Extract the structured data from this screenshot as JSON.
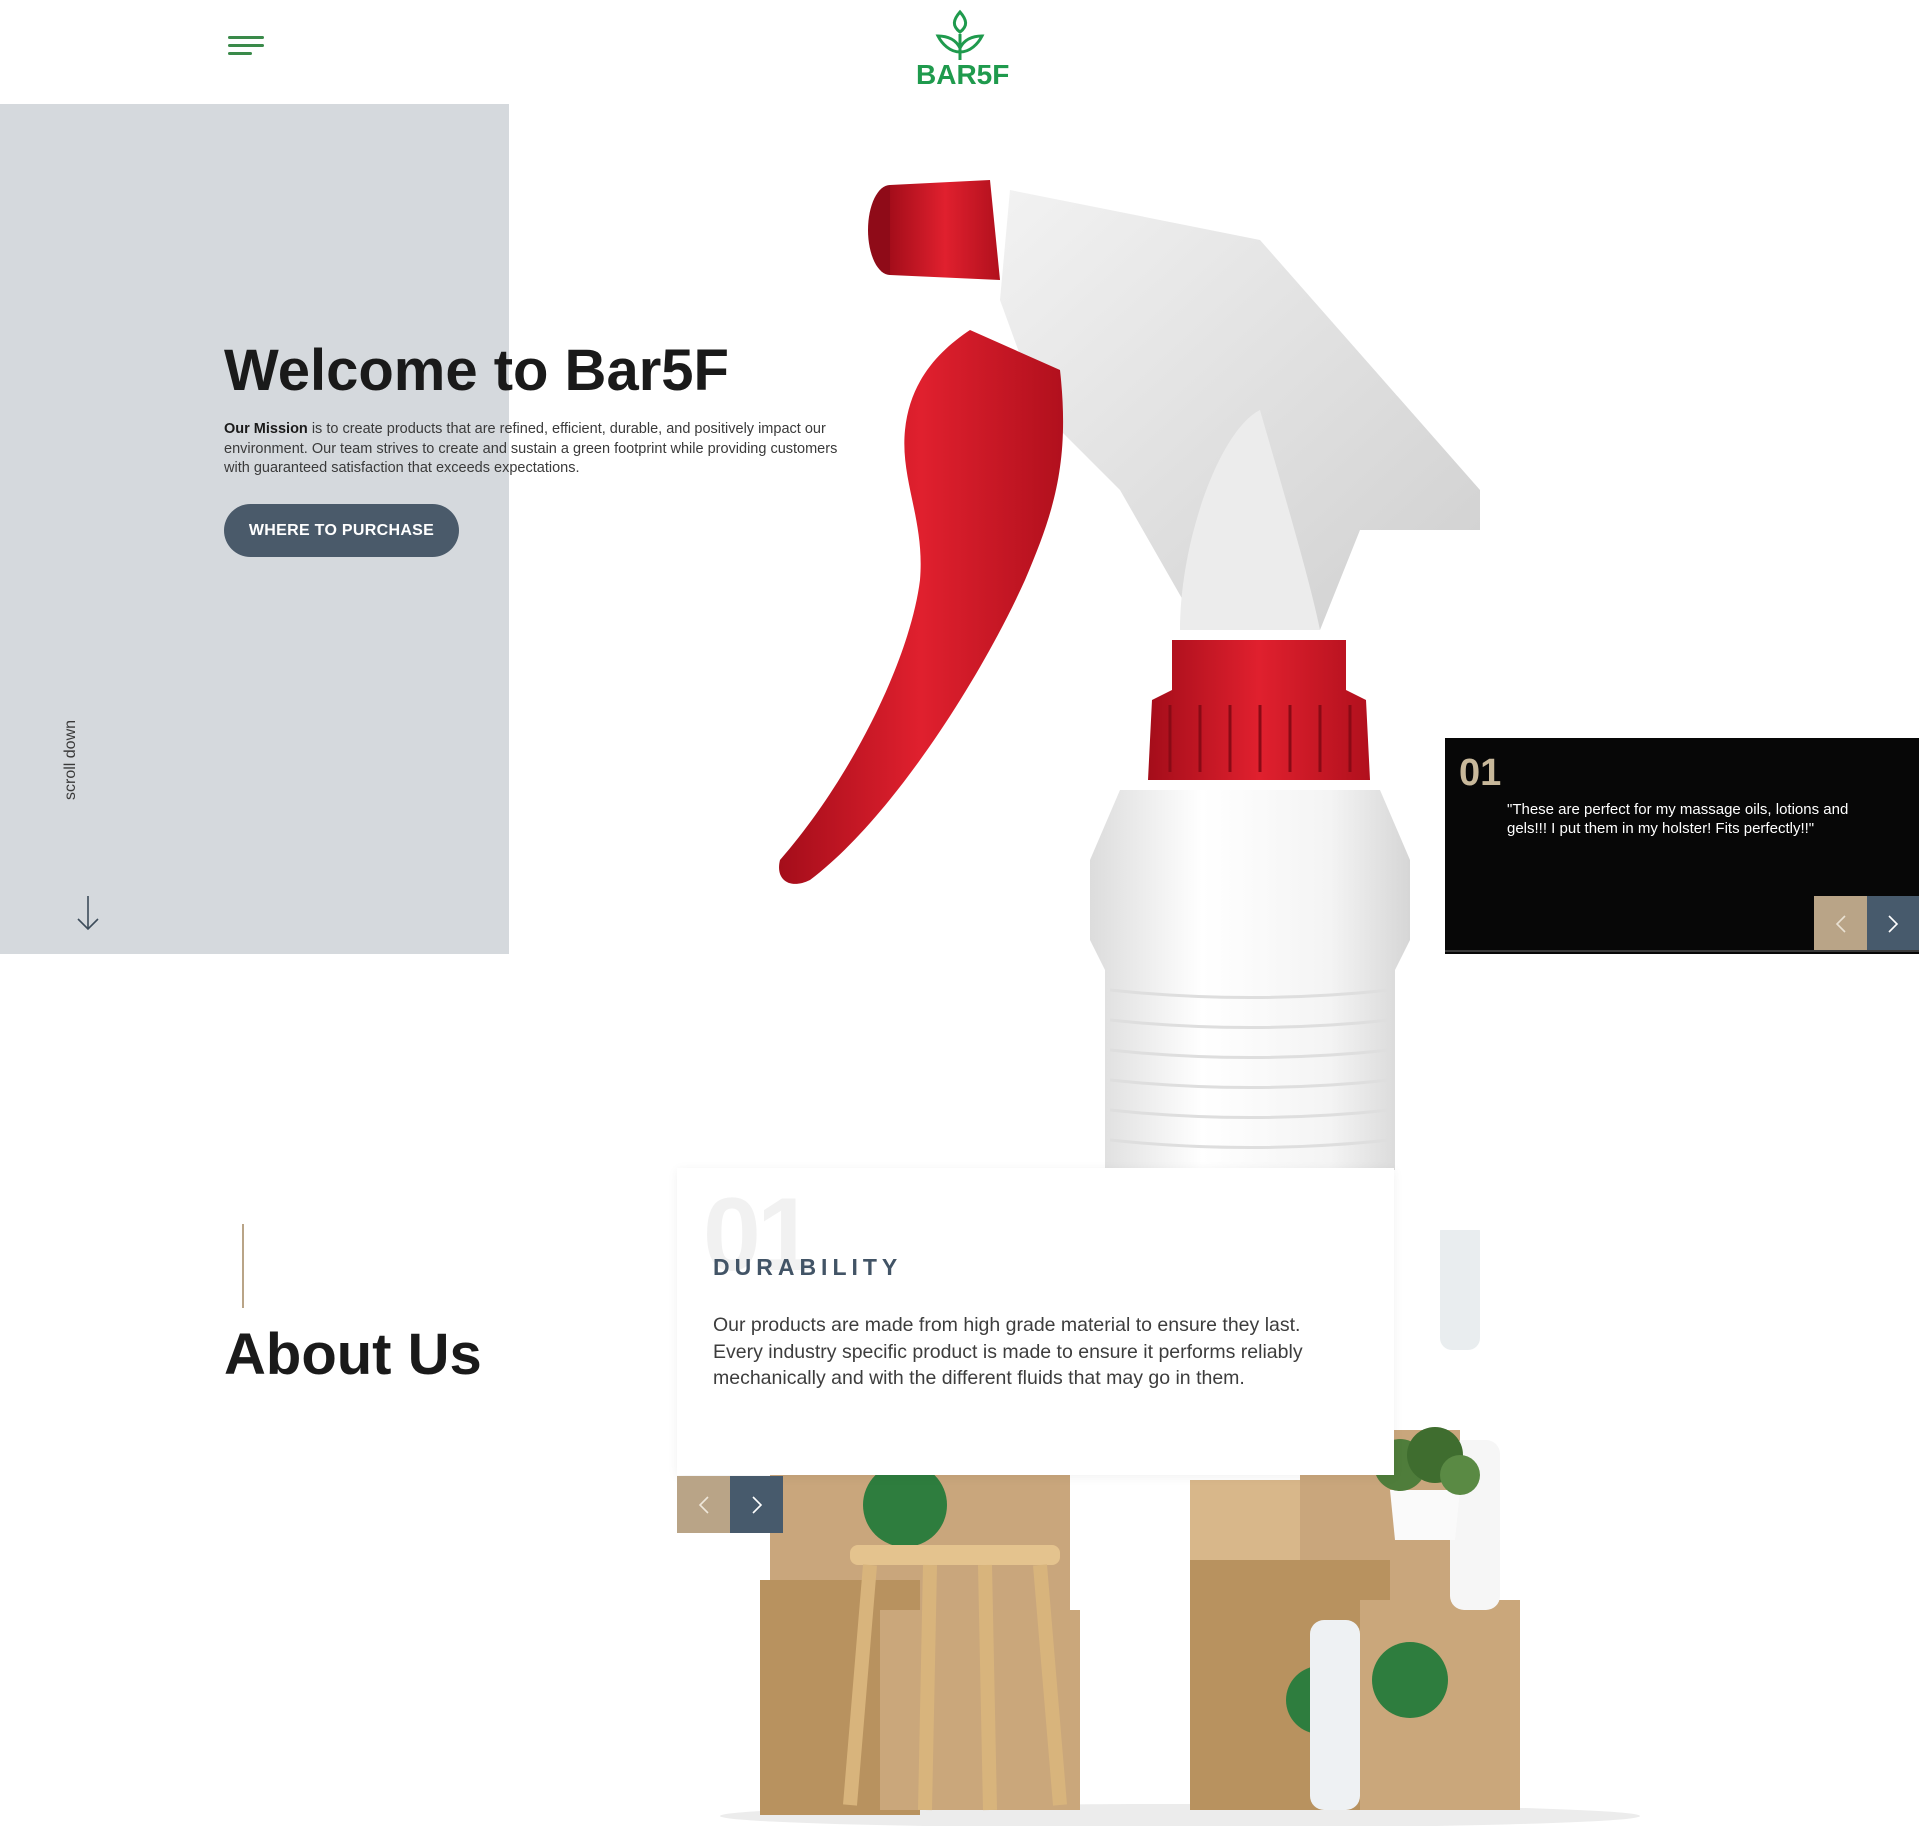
{
  "header": {
    "menu_icon": "hamburger-menu-icon",
    "logo_text": "BAR5F",
    "brand_color": "#1f9a4d"
  },
  "hero": {
    "title": "Welcome to Bar5F",
    "mission_label": "Our Mission",
    "mission_text": " is to create products that are refined, efficient, durable, and positively impact our environment. Our team strives to create and sustain a green footprint while providing customers with guaranteed satisfaction that exceeds expectations.",
    "cta_label": "WHERE TO PURCHASE",
    "scroll_label": "scroll down",
    "product_image": "spray-bottle-image"
  },
  "testimonial": {
    "number": "01",
    "quote": "\"These are perfect for my massage oils, lotions and gels!!! I put them in my holster! Fits perfectly!!\"",
    "prev_icon": "chevron-left-icon",
    "next_icon": "chevron-right-icon"
  },
  "about": {
    "title": "About Us",
    "feature": {
      "number": "01",
      "title": "DURABILITY",
      "text": "Our products are made from high grade material to ensure they last. Every industry specific product is made to ensure it performs reliably mechanically and with the different fluids that may go in them."
    },
    "prev_icon": "chevron-left-icon",
    "next_icon": "chevron-right-icon",
    "image": "shipping-boxes-image"
  },
  "colors": {
    "panel_grey": "#d5d9dd",
    "button_slate": "#4a5a6a",
    "accent_tan": "#b9a487",
    "accent_slate": "#475a6c",
    "dark": "#070707"
  }
}
